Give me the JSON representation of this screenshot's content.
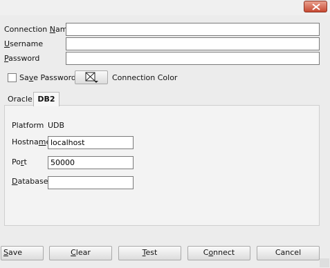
{
  "form": {
    "connection_name": {
      "label_pre": "Connection ",
      "label_u": "N",
      "label_post": "ame",
      "value": ""
    },
    "username": {
      "label_pre": "",
      "label_u": "U",
      "label_post": "sername",
      "value": ""
    },
    "password": {
      "label_pre": "",
      "label_u": "P",
      "label_post": "assword",
      "value": ""
    },
    "save_password": {
      "label_pre": "Sa",
      "label_u": "v",
      "label_post": "e Password",
      "checked": false
    },
    "connection_color_label": "Connection Color"
  },
  "tabs": [
    {
      "label": "Oracle",
      "active": false
    },
    {
      "label": "DB2",
      "active": true
    }
  ],
  "db2": {
    "platform_label": "Platform",
    "platform_value": "UDB",
    "hostname": {
      "label_pre": "Hostna",
      "label_u": "m",
      "label_post": "e",
      "value": "localhost"
    },
    "port": {
      "label_pre": "Po",
      "label_u": "r",
      "label_post": "t",
      "value": "50000"
    },
    "database": {
      "label_pre": "",
      "label_u": "D",
      "label_post": "atabase",
      "value": ""
    }
  },
  "buttons": {
    "save": {
      "pre": "",
      "u": "S",
      "post": "ave"
    },
    "clear": {
      "pre": "",
      "u": "C",
      "post": "lear"
    },
    "test": {
      "pre": "",
      "u": "T",
      "post": "est"
    },
    "connect": {
      "pre": "C",
      "u": "o",
      "post": "nnect"
    },
    "cancel": {
      "pre": "",
      "u": "",
      "post": "Cancel"
    }
  }
}
